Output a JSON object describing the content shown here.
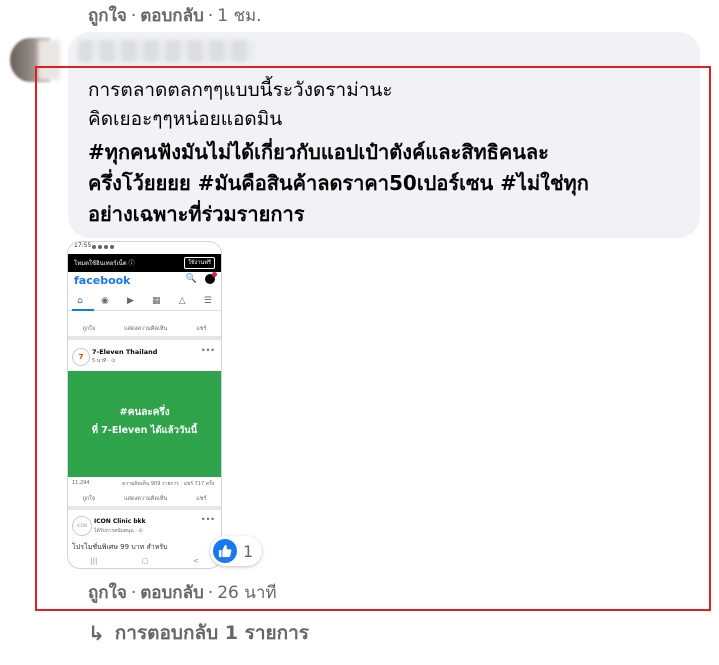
{
  "top_actions": {
    "like": "ถูกใจ",
    "reply": "ตอบกลับ",
    "time": "1 ชม."
  },
  "comment": {
    "line1": "การตลาดตลกๆๆแบบนี้ระวังดราม่านะ",
    "line2": "คิดเยอะๆๆหน่อยแอดมิน",
    "hashtag_line1": "#ทุกคนฟังมันไม่ได้เกี่ยวกับแอปเป๋าตังค์และสิทธิคนละ",
    "hashtag_line2": "ครึ่งโว้ยยยย #มันคือสินค้าลดราคา50เปอร์เซน #ไม่ใช่ทุก",
    "hashtag_line3": "อย่างเฉพาะที่ร่วมรายการ"
  },
  "phone": {
    "status_time": "17:55",
    "banner_text": "โหมดใช้อินเทอร์เน็ต ⓘ",
    "banner_button": "ใช้งานฟรี",
    "app_name": "facebook",
    "react_like": "ถูกใจ",
    "react_comment": "แสดงความคิดเห็น",
    "react_share": "แชร์",
    "page_name": "7-Eleven Thailand",
    "post_time": "5 นาที · ⊙",
    "image_line1": "#คนละครึ่ง",
    "image_line2": "ที่ 7-Eleven ได้แล้ววันนี้",
    "stats_reactions": "11,294",
    "stats_counts": "ความคิดเห็น 909 รายการ · แชร์ 717 ครั้ง",
    "second_page": "ICON Clinic bkk",
    "second_sub": "ได้รับการสนับสนุน · ⊙",
    "bottom_text": "โปรโมชั่นพิเศษ 99 บาท สำหรับ"
  },
  "reaction": {
    "icon": "like-icon",
    "count": "1"
  },
  "bottom_actions": {
    "like": "ถูกใจ",
    "reply": "ตอบกลับ",
    "time": "26 นาที"
  },
  "replies": {
    "label": "การตอบกลับ 1 รายการ"
  },
  "colors": {
    "highlight": "#e02020",
    "facebook_blue": "#1877f2",
    "bubble": "#f0f2f5",
    "meta_text": "#65676b",
    "promo_green": "#2ea34a"
  }
}
